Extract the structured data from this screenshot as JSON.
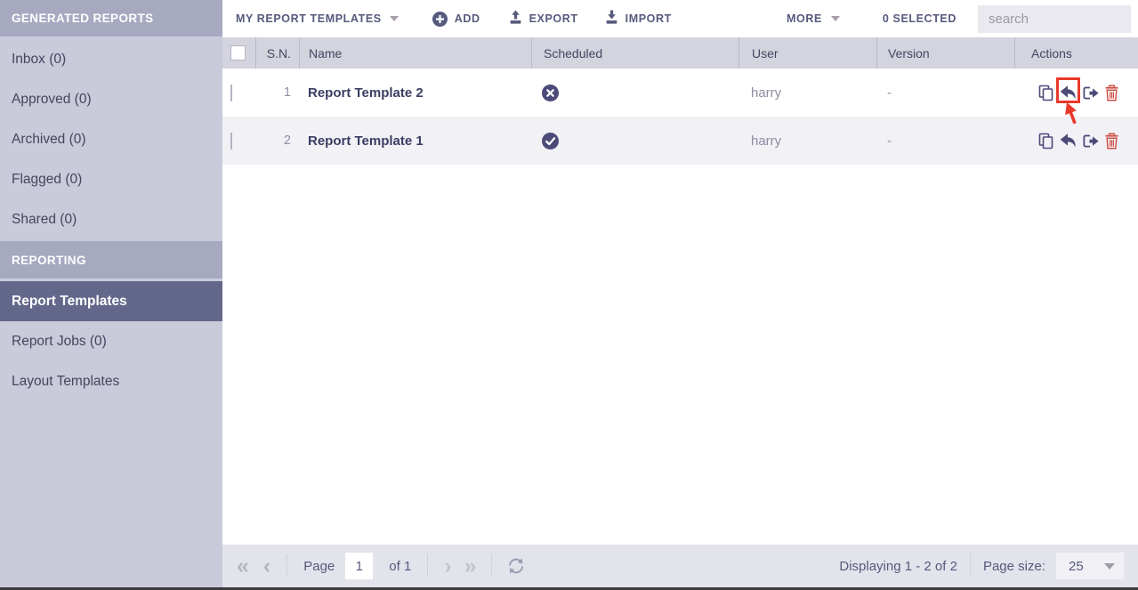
{
  "sidebar": {
    "sections": [
      {
        "header": "GENERATED REPORTS",
        "items": [
          "Inbox (0)",
          "Approved (0)",
          "Archived (0)",
          "Flagged (0)",
          "Shared (0)"
        ]
      },
      {
        "header": "REPORTING",
        "items": [
          "Report Templates",
          "Report Jobs (0)",
          "Layout Templates"
        ],
        "selected_item": "Report Templates"
      }
    ]
  },
  "toolbar": {
    "menu_label": "MY REPORT TEMPLATES",
    "add_label": "ADD",
    "export_label": "EXPORT",
    "import_label": "IMPORT",
    "more_label": "MORE",
    "selected_count": "0 SELECTED",
    "search_placeholder": "search"
  },
  "table": {
    "headers": {
      "sn": "S.N.",
      "name": "Name",
      "scheduled": "Scheduled",
      "user": "User",
      "version": "Version",
      "actions": "Actions"
    },
    "rows": [
      {
        "sn": "1",
        "name": "Report Template 2",
        "scheduled": false,
        "user": "harry",
        "version": "-"
      },
      {
        "sn": "2",
        "name": "Report Template 1",
        "scheduled": true,
        "user": "harry",
        "version": "-"
      }
    ]
  },
  "pagination": {
    "page_label": "Page",
    "page_value": "1",
    "of_label": "of 1",
    "displaying": "Displaying 1 - 2 of 2",
    "page_size_label": "Page size:",
    "page_size_value": "25"
  },
  "icons": {
    "add": "plus-circle",
    "export": "upload-tray",
    "import": "download-tray",
    "menu_caret": "triangle-down",
    "scheduled_no": "x-circle",
    "scheduled_yes": "check-circle",
    "copy": "copy-pages",
    "revert": "undo-arrow",
    "export_row": "arrow-out-box",
    "delete": "trash-can",
    "refresh": "refresh-arrows",
    "first": "double-chevron-left",
    "prev": "chevron-left",
    "next": "chevron-right",
    "last": "double-chevron-right"
  },
  "colors": {
    "annotation_red": "#e8392b",
    "slate": "#565a7c",
    "icon_navy": "#4c4a78",
    "trash_red": "#cf5148",
    "sidebar_selected": "#63678a",
    "header_bg": "#d3d4de"
  }
}
